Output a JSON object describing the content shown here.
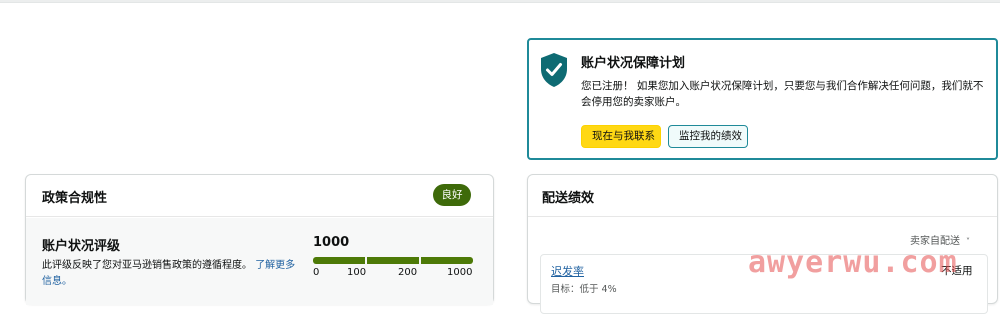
{
  "aha_card": {
    "title": "账户状况保障计划",
    "body": "您已注册！ 如果您加入账户状况保障计划，只要您与我们合作解决任何问题，我们就不会停用您的卖家账户。",
    "contact_button": "现在与我联系",
    "monitor_button": "监控我的绩效",
    "icon": "shield-check-icon",
    "accent_color": "#1f8a99"
  },
  "policy_card": {
    "title": "政策合规性",
    "status_badge": "良好",
    "status_color": "#3e6a0a",
    "ahr_title": "账户状况评级",
    "ahr_desc": "此评级反映了您对亚马逊销售政策的遵循程度。",
    "ahr_link": "了解更多信息。",
    "score": "1000",
    "scale_labels": [
      "0",
      "100",
      "200",
      "1000"
    ]
  },
  "shipping_card": {
    "title": "配送绩效",
    "fulfillment_select": "卖家自配送",
    "late_rate_label": "迟发率",
    "late_rate_status": "不适用",
    "late_rate_target": "目标：低于 4%"
  },
  "watermark": "awyerwu.com"
}
